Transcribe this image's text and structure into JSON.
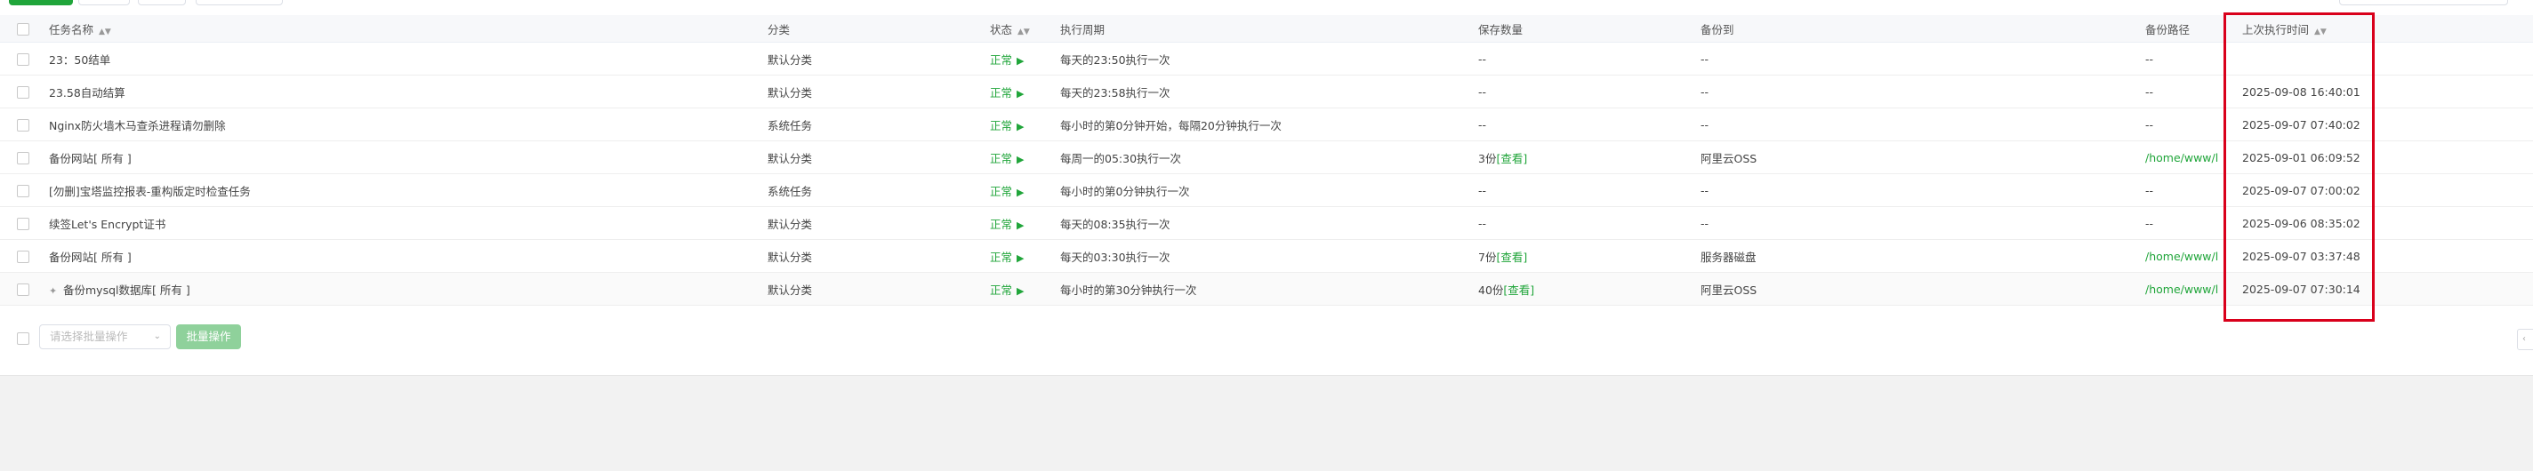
{
  "columns": {
    "name": "任务名称",
    "category": "分类",
    "status": "状态",
    "cycle": "执行周期",
    "keep": "保存数量",
    "backup_to": "备份到",
    "backup_path": "备份路径",
    "last_run": "上次执行时间"
  },
  "rows": [
    {
      "name": "23：50结单",
      "category": "默认分类",
      "status": "正常",
      "cycle": "每天的23:50执行一次",
      "keep_count": "--",
      "keep_link": "",
      "backup_to": "--",
      "backup_path": "--",
      "last_run": ""
    },
    {
      "name": "23.58自动结算",
      "category": "默认分类",
      "status": "正常",
      "cycle": "每天的23:58执行一次",
      "keep_count": "--",
      "keep_link": "",
      "backup_to": "--",
      "backup_path": "--",
      "last_run": "2025-09-08 16:40:01"
    },
    {
      "name": "Nginx防火墙木马查杀进程请勿删除",
      "category": "系统任务",
      "status": "正常",
      "cycle": "每小时的第0分钟开始，每隔20分钟执行一次",
      "keep_count": "--",
      "keep_link": "",
      "backup_to": "--",
      "backup_path": "--",
      "last_run": "2025-09-07 07:40:02"
    },
    {
      "name": "备份网站[ 所有 ]",
      "category": "默认分类",
      "status": "正常",
      "cycle": "每周一的05:30执行一次",
      "keep_count": "3份",
      "keep_link": "[查看]",
      "backup_to": "阿里云OSS",
      "backup_path": "/home/www/l",
      "last_run": "2025-09-01 06:09:52"
    },
    {
      "name": "[勿删]宝塔监控报表-重构版定时检查任务",
      "category": "系统任务",
      "status": "正常",
      "cycle": "每小时的第0分钟执行一次",
      "keep_count": "--",
      "keep_link": "",
      "backup_to": "--",
      "backup_path": "--",
      "last_run": "2025-09-07 07:00:02"
    },
    {
      "name": "续签Let's Encrypt证书",
      "category": "默认分类",
      "status": "正常",
      "cycle": "每天的08:35执行一次",
      "keep_count": "--",
      "keep_link": "",
      "backup_to": "--",
      "backup_path": "--",
      "last_run": "2025-09-06 08:35:02"
    },
    {
      "name": "备份网站[ 所有 ]",
      "category": "默认分类",
      "status": "正常",
      "cycle": "每天的03:30执行一次",
      "keep_count": "7份",
      "keep_link": "[查看]",
      "backup_to": "服务器磁盘",
      "backup_path": "/home/www/l",
      "last_run": "2025-09-07 03:37:48"
    },
    {
      "name": "备份mysql数据库[ 所有 ]",
      "category": "默认分类",
      "status": "正常",
      "cycle": "每小时的第30分钟执行一次",
      "keep_count": "40份",
      "keep_link": "[查看]",
      "backup_to": "阿里云OSS",
      "backup_path": "/home/www/l",
      "last_run": "2025-09-07 07:30:14"
    }
  ],
  "footer": {
    "batch_placeholder": "请选择批量操作",
    "batch_button": "批量操作"
  },
  "colors": {
    "accent": "#20a53a",
    "highlight_box": "#d9001b"
  },
  "icons": {
    "sort": "sort-arrows-icon",
    "run": "play-triangle-icon",
    "pin": "pin-icon",
    "dropdown": "chevron-down-icon",
    "pager": "chevron-left-icon"
  }
}
